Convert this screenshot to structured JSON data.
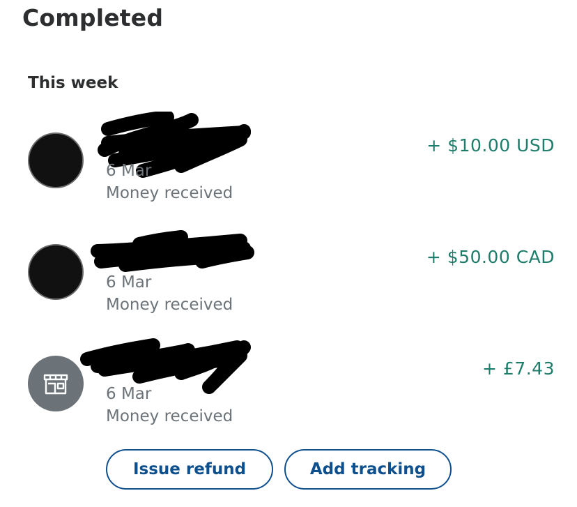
{
  "header": {
    "title": "Completed"
  },
  "section": {
    "title": "This week"
  },
  "transactions": [
    {
      "name": "",
      "date": "6 Mar",
      "description": "Money received",
      "amount": "+ $10.00 USD",
      "avatar": "dark-circle"
    },
    {
      "name": "",
      "date": "6 Mar",
      "description": "Money received",
      "amount": "+ $50.00 CAD",
      "avatar": "dark-circle"
    },
    {
      "name": "",
      "date": "6 Mar",
      "description": "Money received",
      "amount": "+ £7.43",
      "avatar": "store-icon"
    }
  ],
  "actions": {
    "refund_label": "Issue refund",
    "tracking_label": "Add tracking"
  },
  "colors": {
    "amount": "#1e7d6a",
    "button": "#0e4f8d",
    "muted_text": "#6c7378",
    "store_avatar": "#6c7378"
  }
}
